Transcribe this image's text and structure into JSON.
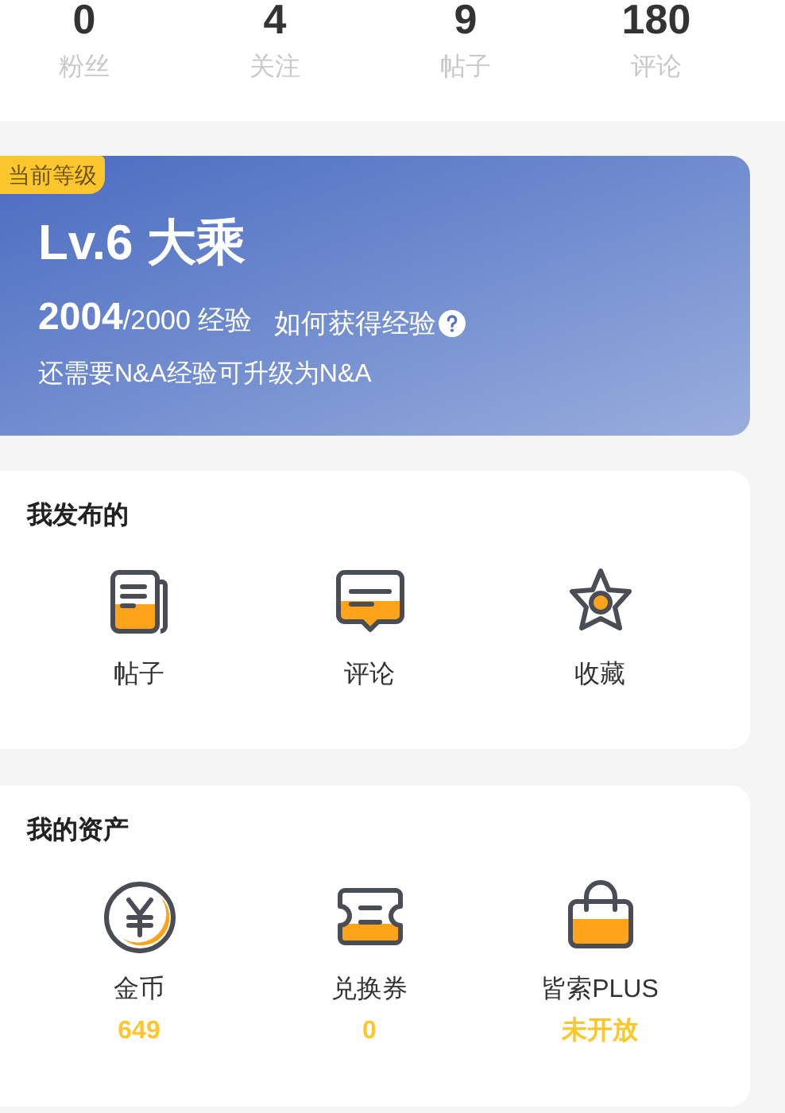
{
  "stats": [
    {
      "value": "0",
      "label": "粉丝"
    },
    {
      "value": "4",
      "label": "关注"
    },
    {
      "value": "9",
      "label": "帖子"
    },
    {
      "value": "180",
      "label": "评论"
    }
  ],
  "level_card": {
    "badge": "当前等级",
    "title": "Lv.6 大乘",
    "exp_current": "2004",
    "exp_total": "/2000 经验",
    "help_link": "如何获得经验",
    "hint": "还需要N&A经验可升级为N&A"
  },
  "sections": [
    {
      "title": "我发布的",
      "items": [
        {
          "label": "帖子"
        },
        {
          "label": "评论"
        },
        {
          "label": "收藏"
        }
      ]
    },
    {
      "title": "我的资产",
      "items": [
        {
          "label": "金币",
          "value": "649"
        },
        {
          "label": "兑换券",
          "value": "0"
        },
        {
          "label": "皆索PLUS",
          "value": "未开放"
        }
      ]
    }
  ]
}
